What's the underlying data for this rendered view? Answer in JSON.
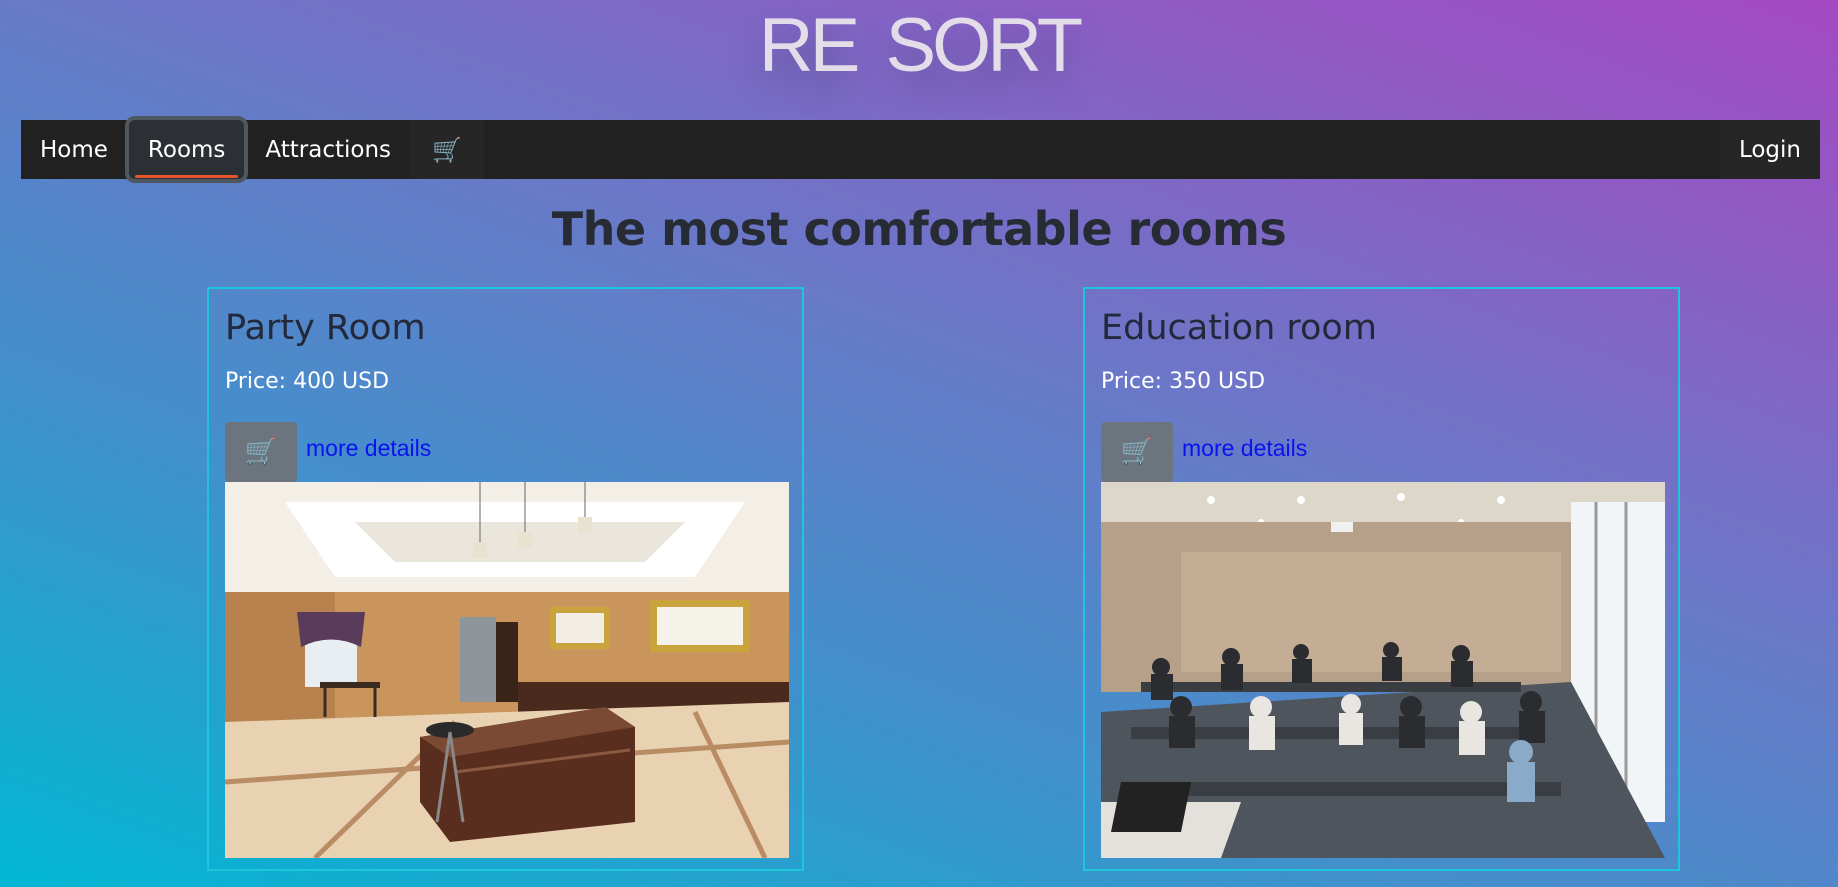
{
  "logo": "RE SORT",
  "nav": {
    "items": [
      {
        "label": "Home"
      },
      {
        "label": "Rooms"
      },
      {
        "label": "Attractions"
      }
    ],
    "cart_icon": "🛒",
    "login": "Login"
  },
  "headline": "The most comfortable rooms",
  "rooms": [
    {
      "title": "Party Room",
      "price": "Price: 400 USD",
      "cart_icon": "🛒",
      "link": "more details"
    },
    {
      "title": "Education room",
      "price": "Price: 350 USD",
      "cart_icon": "🛒",
      "link": "more details"
    }
  ],
  "colors": {
    "navbar": "#212121",
    "active_underline": "#e5542a",
    "card_border": "#1ec6dc",
    "link": "#0a12f0"
  }
}
